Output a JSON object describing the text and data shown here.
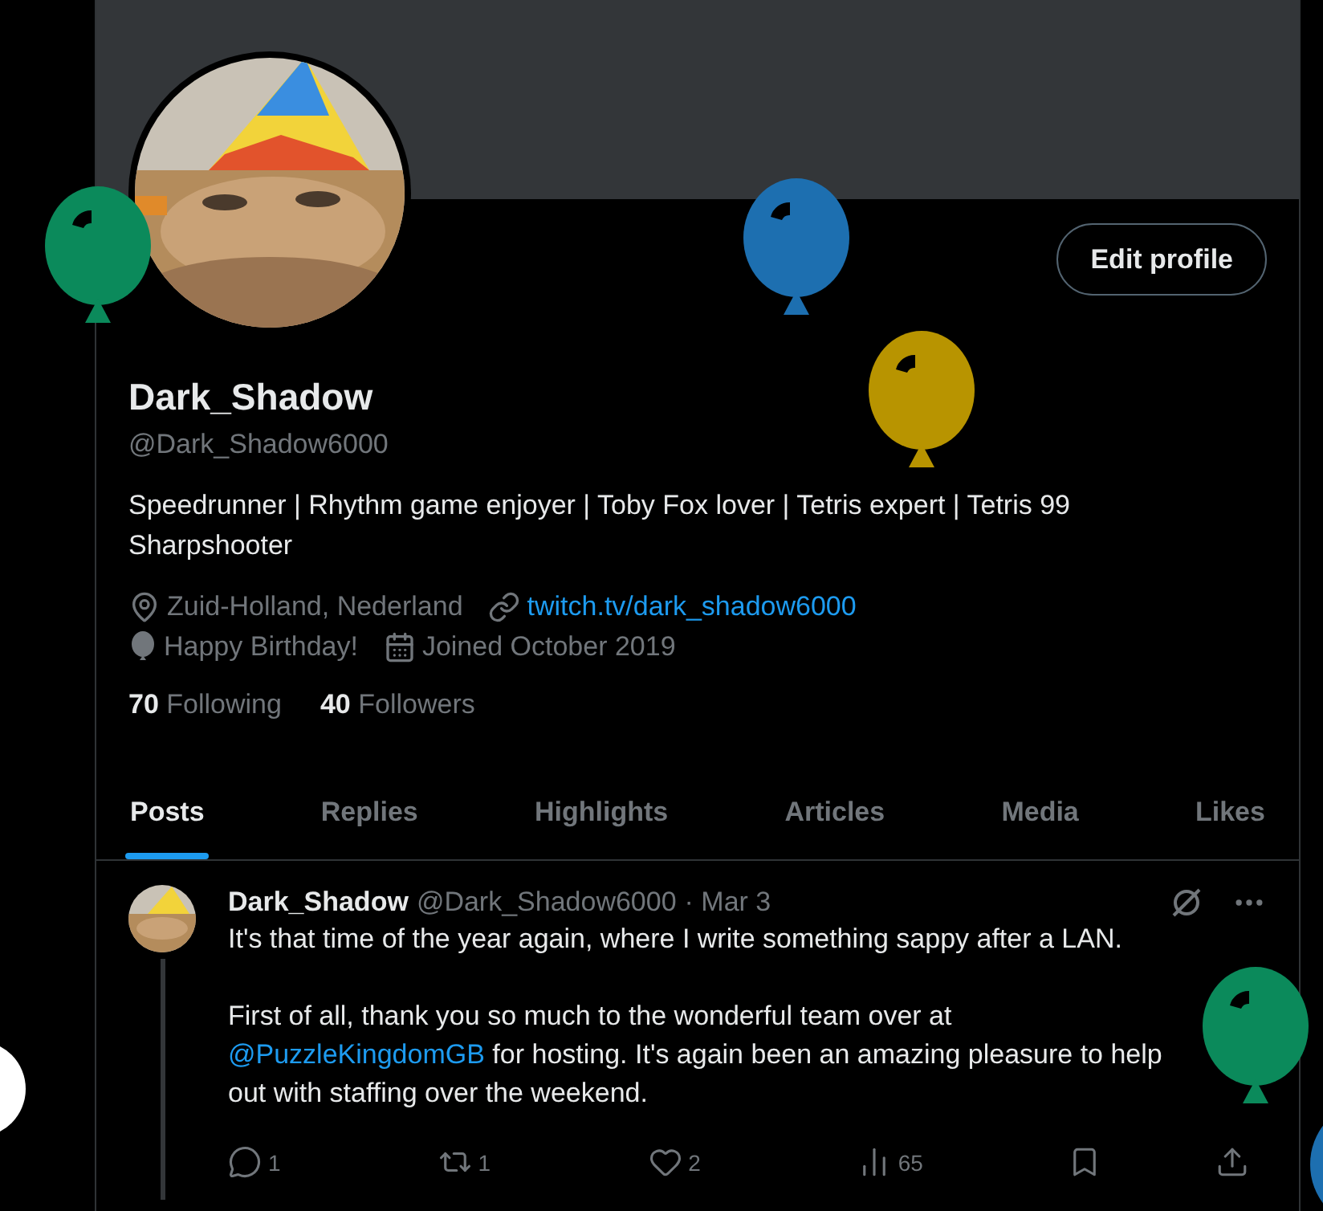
{
  "profile": {
    "edit_button": "Edit profile",
    "name": "Dark_Shadow",
    "handle": "@Dark_Shadow6000",
    "bio": "Speedrunner | Rhythm game enjoyer | Toby Fox lover | Tetris expert | Tetris 99 Sharpshooter",
    "details": [
      {
        "kind": "location",
        "text": "Zuid-Holland, Nederland"
      },
      {
        "kind": "link",
        "text": "twitch.tv/dark_shadow6000"
      },
      {
        "kind": "birthday",
        "text": "Happy Birthday!"
      },
      {
        "kind": "joined",
        "text": "Joined October 2019"
      }
    ],
    "stats": [
      {
        "count": "70",
        "label": "Following"
      },
      {
        "count": "40",
        "label": "Followers"
      }
    ]
  },
  "tabs": [
    {
      "label": "Posts",
      "selected": true
    },
    {
      "label": "Replies",
      "selected": false
    },
    {
      "label": "Highlights",
      "selected": false
    },
    {
      "label": "Articles",
      "selected": false
    },
    {
      "label": "Media",
      "selected": false
    },
    {
      "label": "Likes",
      "selected": false
    }
  ],
  "post": {
    "name": "Dark_Shadow",
    "handle": "@Dark_Shadow6000",
    "date": "· Mar 3",
    "first_paragraph": "It's that time of the year again, where I write something sappy after a LAN.",
    "second_paragraph": {
      "before": "First of all, thank you so much to the wonderful team over at ",
      "mention": "@PuzzleKingdomGB",
      "after": " for hosting. It's again been an amazing pleasure to help out with staffing over the weekend."
    },
    "actions": [
      {
        "kind": "reply",
        "count": "1"
      },
      {
        "kind": "repost",
        "count": "1"
      },
      {
        "kind": "like",
        "count": "2"
      },
      {
        "kind": "views",
        "count": "65"
      },
      {
        "kind": "bookmark"
      },
      {
        "kind": "share"
      }
    ]
  },
  "balloons": [
    {
      "color": "#0b8a5b"
    },
    {
      "color": "#1d6fb0"
    },
    {
      "color": "#b89400"
    },
    {
      "color": "#0b8a5b"
    },
    {
      "color": "#1d6fb0"
    }
  ]
}
